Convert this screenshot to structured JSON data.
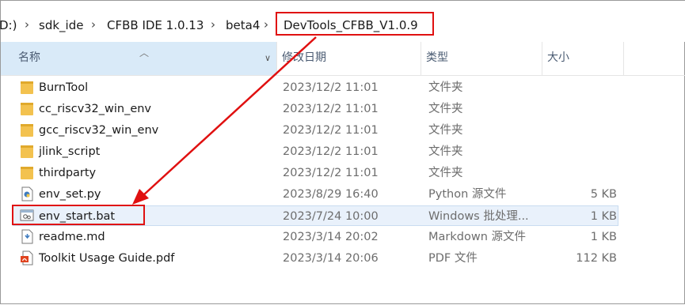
{
  "breadcrumb": {
    "drive_fragment": "D:)",
    "items": [
      "sdk_ide",
      "CFBB IDE 1.0.13",
      "beta4",
      "DevTools_CFBB_V1.0.9"
    ],
    "separator": "›"
  },
  "columns": {
    "name": "名称",
    "date": "修改日期",
    "type": "类型",
    "size": "大小"
  },
  "files": [
    {
      "name": "BurnTool",
      "date": "2023/12/2 11:01",
      "type": "文件夹",
      "size": "",
      "icon": "folder-icon"
    },
    {
      "name": "cc_riscv32_win_env",
      "date": "2023/12/2 11:01",
      "type": "文件夹",
      "size": "",
      "icon": "folder-icon"
    },
    {
      "name": "gcc_riscv32_win_env",
      "date": "2023/12/2 11:01",
      "type": "文件夹",
      "size": "",
      "icon": "folder-icon"
    },
    {
      "name": "jlink_script",
      "date": "2023/12/2 11:01",
      "type": "文件夹",
      "size": "",
      "icon": "folder-icon"
    },
    {
      "name": "thirdparty",
      "date": "2023/12/2 11:01",
      "type": "文件夹",
      "size": "",
      "icon": "folder-icon"
    },
    {
      "name": "env_set.py",
      "date": "2023/8/29 16:40",
      "type": "Python 源文件",
      "size": "5 KB",
      "icon": "python-file-icon"
    },
    {
      "name": "env_start.bat",
      "date": "2023/7/24 10:00",
      "type": "Windows 批处理...",
      "size": "1 KB",
      "icon": "batch-file-icon"
    },
    {
      "name": "readme.md",
      "date": "2023/3/14 20:02",
      "type": "Markdown 源文件",
      "size": "1 KB",
      "icon": "markdown-file-icon"
    },
    {
      "name": "Toolkit Usage Guide.pdf",
      "date": "2023/3/14 20:06",
      "type": "PDF 文件",
      "size": "112 KB",
      "icon": "pdf-file-icon"
    }
  ],
  "colors": {
    "annotation": "#e01010",
    "selected_row": "#e9f1fb",
    "header_active": "#d9eaf8",
    "folder": "#f3c24f"
  }
}
